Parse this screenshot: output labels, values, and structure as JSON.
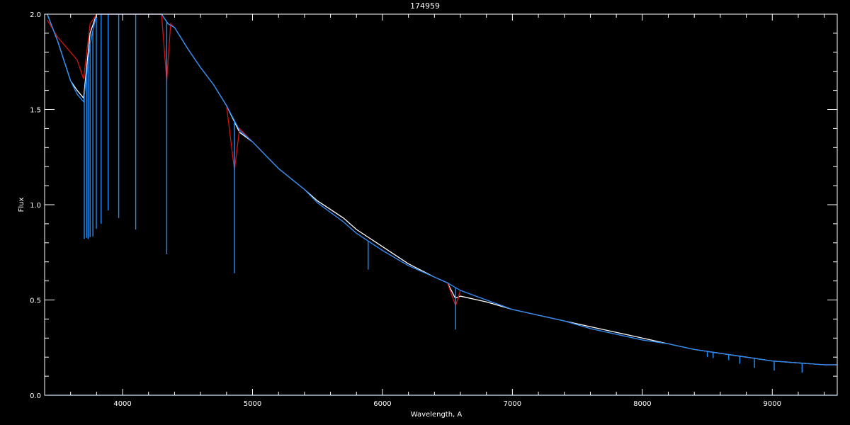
{
  "chart_data": {
    "type": "line",
    "title": "174959",
    "xlabel": "Wavelength, A",
    "ylabel": "Flux",
    "xlim": [
      3400,
      9500
    ],
    "ylim": [
      0.0,
      2.0
    ],
    "x_ticks": [
      4000,
      5000,
      6000,
      7000,
      8000,
      9000
    ],
    "x_tick_labels": [
      "4000",
      "5000",
      "6000",
      "7000",
      "8000",
      "9000"
    ],
    "y_ticks": [
      0.0,
      0.5,
      1.0,
      1.5,
      2.0
    ],
    "y_tick_labels": [
      "0.0",
      "0.5",
      "1.0",
      "1.5",
      "2.0"
    ],
    "grid": false,
    "background": "#000000",
    "axis_color": "#ffffff",
    "series": [
      {
        "color": "#ffffff",
        "x": [
          3420,
          3500,
          3600,
          3650,
          3700,
          3750,
          3800,
          3900,
          4000,
          4100,
          4200,
          4300,
          4350,
          4400,
          4500,
          4600,
          4700,
          4800,
          4900,
          5000,
          5200,
          5400,
          5500,
          5700,
          5800,
          6000,
          6200,
          6400,
          6500,
          6560,
          6600,
          6800,
          7000,
          7200,
          7400,
          7600,
          7800,
          8000,
          8200,
          8400,
          8600,
          8800,
          9000,
          9200,
          9400,
          9500
        ],
        "y": [
          2.0,
          1.86,
          1.65,
          1.6,
          1.56,
          1.9,
          2.0,
          2.0,
          2.0,
          2.0,
          2.0,
          2.0,
          1.95,
          1.93,
          1.82,
          1.72,
          1.63,
          1.52,
          1.38,
          1.33,
          1.19,
          1.08,
          1.02,
          0.93,
          0.87,
          0.78,
          0.69,
          0.62,
          0.59,
          0.51,
          0.52,
          0.49,
          0.45,
          0.42,
          0.39,
          0.36,
          0.33,
          0.3,
          0.27,
          0.24,
          0.22,
          0.2,
          0.18,
          0.17,
          0.16,
          0.16
        ]
      },
      {
        "color": "#d21414",
        "x": [
          3420,
          3500,
          3600,
          3650,
          3700,
          3750,
          3800,
          3900,
          4000,
          4100,
          4200,
          4300,
          4340,
          4370,
          4400,
          4500,
          4600,
          4700,
          4800,
          4861,
          4900,
          5000,
          5200,
          5400,
          5500,
          5700,
          5800,
          6000,
          6200,
          6400,
          6500,
          6563,
          6600,
          6800,
          7000,
          7200,
          7400,
          7600,
          7800,
          8000,
          8200,
          8400,
          8600,
          8800,
          9000,
          9200,
          9400,
          9500
        ],
        "y": [
          1.97,
          1.88,
          1.8,
          1.76,
          1.66,
          1.95,
          2.0,
          2.0,
          2.0,
          2.0,
          2.0,
          2.0,
          1.65,
          1.95,
          1.93,
          1.82,
          1.72,
          1.63,
          1.52,
          1.18,
          1.4,
          1.33,
          1.19,
          1.08,
          1.01,
          0.91,
          0.85,
          0.76,
          0.68,
          0.62,
          0.59,
          0.47,
          0.55,
          0.5,
          0.45,
          0.42,
          0.39,
          0.35,
          0.32,
          0.29,
          0.27,
          0.24,
          0.22,
          0.2,
          0.18,
          0.17,
          0.16,
          0.16
        ]
      },
      {
        "color": "#1e90ff",
        "x": [
          3420,
          3500,
          3600,
          3650,
          3700,
          3750,
          3800,
          3900,
          4000,
          4100,
          4200,
          4300,
          4350,
          4400,
          4500,
          4600,
          4700,
          4800,
          4900,
          5000,
          5200,
          5400,
          5500,
          5700,
          5800,
          6000,
          6200,
          6400,
          6500,
          6600,
          6800,
          7000,
          7200,
          7400,
          7600,
          7800,
          8000,
          8200,
          8400,
          8600,
          8800,
          9000,
          9200,
          9400,
          9500
        ],
        "y": [
          2.0,
          1.86,
          1.65,
          1.58,
          1.54,
          1.85,
          2.0,
          2.0,
          2.0,
          2.0,
          2.0,
          2.0,
          1.95,
          1.93,
          1.82,
          1.72,
          1.63,
          1.52,
          1.39,
          1.33,
          1.19,
          1.08,
          1.01,
          0.91,
          0.85,
          0.76,
          0.68,
          0.62,
          0.59,
          0.55,
          0.5,
          0.45,
          0.42,
          0.39,
          0.35,
          0.32,
          0.29,
          0.27,
          0.24,
          0.22,
          0.2,
          0.18,
          0.17,
          0.16,
          0.16
        ]
      },
      {
        "color": "#1e90ff",
        "x": [
          3420,
          4000,
          5000,
          6000,
          7000,
          8000,
          9000,
          9500
        ],
        "y": [
          0.0,
          0.0,
          0.0,
          0.0,
          0.0,
          0.0,
          0.0,
          0.0
        ]
      }
    ],
    "absorption_lines": [
      {
        "x": 3705,
        "depth": 0.75
      },
      {
        "x": 3722,
        "depth": 0.85
      },
      {
        "x": 3734,
        "depth": 0.93
      },
      {
        "x": 3750,
        "depth": 1.02
      },
      {
        "x": 3771,
        "depth": 1.08
      },
      {
        "x": 3798,
        "depth": 1.12
      },
      {
        "x": 3835,
        "depth": 1.1
      },
      {
        "x": 3889,
        "depth": 1.03
      },
      {
        "x": 3970,
        "depth": 1.07
      },
      {
        "x": 4101,
        "depth": 1.13
      },
      {
        "x": 4340,
        "depth": 1.22
      },
      {
        "x": 4861,
        "depth": 0.8
      },
      {
        "x": 5890,
        "depth": 0.15
      },
      {
        "x": 6563,
        "depth": 0.22
      },
      {
        "x": 8500,
        "depth": 0.03
      },
      {
        "x": 8545,
        "depth": 0.03
      },
      {
        "x": 8665,
        "depth": 0.03
      },
      {
        "x": 8750,
        "depth": 0.04
      },
      {
        "x": 8863,
        "depth": 0.05
      },
      {
        "x": 9015,
        "depth": 0.05
      },
      {
        "x": 9229,
        "depth": 0.05
      }
    ]
  }
}
